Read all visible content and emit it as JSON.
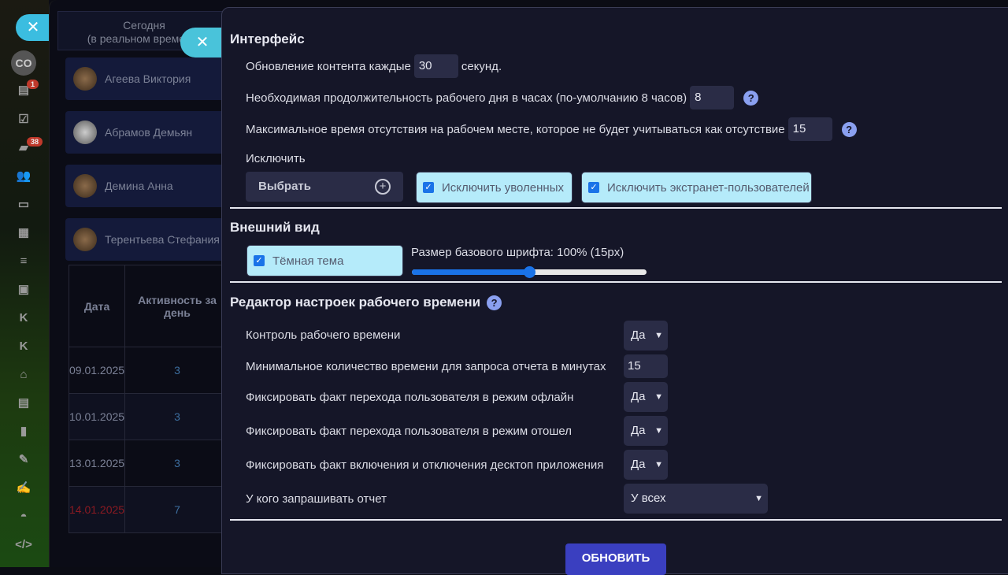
{
  "sidebar": {
    "avatar": "CO",
    "badges": {
      "calendar": "1",
      "chat": "38"
    },
    "k1": "K",
    "k2": "K"
  },
  "left": {
    "today": "Сегодня",
    "today_sub": "(в реальном времени)",
    "people": [
      "Агеева Виктория",
      "Абрамов Демьян",
      "Демина Анна",
      "Терентьева Стефания"
    ],
    "table": {
      "headers": [
        "Дата",
        "Активность за день"
      ],
      "rows": [
        {
          "date": "09.01.2025",
          "value": "3"
        },
        {
          "date": "10.01.2025",
          "value": "3"
        },
        {
          "date": "13.01.2025",
          "value": "3"
        },
        {
          "date": "14.01.2025",
          "value": "7"
        }
      ]
    }
  },
  "panel": {
    "interface": {
      "title": "Интерфейс",
      "refresh_label": "Обновление контента каждые",
      "refresh_value": "30",
      "refresh_unit": "секунд.",
      "workday_label": "Необходимая продолжительность рабочего дня в часах (по-умолчанию 8 часов)",
      "workday_value": "8",
      "absence_label": "Максимальное время отсутствия на рабочем месте, которое не будет учитываться как отсутствие",
      "absence_value": "15",
      "exclude_label": "Исключить",
      "select_button": "Выбрать",
      "exclude_fired": "Исключить уволенных",
      "exclude_extranet": "Исключить экстранет-пользователей"
    },
    "appearance": {
      "title": "Внешний вид",
      "dark_theme": "Тёмная тема",
      "font_size_label": "Размер базового шрифта: 100% (15px)",
      "font_size_percent": 100
    },
    "worktime": {
      "title": "Редактор настроек рабочего времени",
      "rows": [
        {
          "label": "Контроль рабочего времени",
          "value": "Да"
        },
        {
          "label": "Минимальное количество времени для запроса отчета в минутах",
          "value": "15"
        },
        {
          "label": "Фиксировать факт перехода пользователя в режим офлайн",
          "value": "Да"
        },
        {
          "label": "Фиксировать факт перехода пользователя в режим отошел",
          "value": "Да"
        },
        {
          "label": "Фиксировать факт включения и отключения десктоп приложения",
          "value": "Да"
        },
        {
          "label": "У кого запрашивать отчет",
          "value": "У всех"
        }
      ]
    },
    "update_button": "ОБНОВИТЬ"
  }
}
